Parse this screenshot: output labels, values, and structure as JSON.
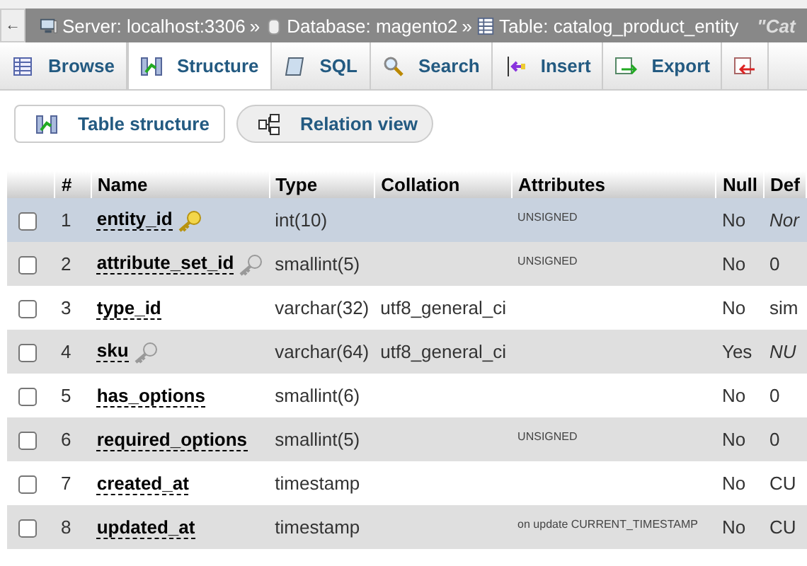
{
  "breadcrumb": {
    "back": "←",
    "items": [
      {
        "kind": "server",
        "label": "Server: localhost:3306"
      },
      {
        "kind": "database",
        "label": "Database: magento2"
      },
      {
        "kind": "table",
        "label": "Table: catalog_product_entity"
      }
    ],
    "separator": "»",
    "comment": "\"Cat"
  },
  "tabs": [
    {
      "kind": "browse",
      "label": "Browse",
      "selected": false
    },
    {
      "kind": "structure",
      "label": "Structure",
      "selected": true
    },
    {
      "kind": "sql",
      "label": "SQL",
      "selected": false
    },
    {
      "kind": "search",
      "label": "Search",
      "selected": false
    },
    {
      "kind": "insert",
      "label": "Insert",
      "selected": false
    },
    {
      "kind": "export",
      "label": "Export",
      "selected": false
    },
    {
      "kind": "import",
      "selected": false
    }
  ],
  "subtabs": [
    {
      "kind": "structure",
      "label": "Table structure",
      "selected": true
    },
    {
      "kind": "relation",
      "label": "Relation view",
      "selected": false
    }
  ],
  "table": {
    "columns": [
      "#",
      "Name",
      "Type",
      "Collation",
      "Attributes",
      "Null",
      "Def"
    ],
    "rows": [
      {
        "num": "1",
        "name": "entity_id",
        "kind": "primary_key",
        "type": "int(10)",
        "collation": "",
        "attributes": "UNSIGNED",
        "null": "No",
        "default": "Nor",
        "default_italic": true,
        "highlighted": true,
        "checked": false
      },
      {
        "num": "2",
        "name": "attribute_set_id",
        "kind": "index_key",
        "type": "smallint(5)",
        "collation": "",
        "attributes": "UNSIGNED",
        "null": "No",
        "default": "0",
        "default_italic": false,
        "highlighted": false,
        "checked": false
      },
      {
        "num": "3",
        "name": "type_id",
        "kind": "plain",
        "type": "varchar(32)",
        "collation": "utf8_general_ci",
        "attributes": "",
        "null": "No",
        "default": "sim",
        "default_italic": false,
        "highlighted": false,
        "checked": false
      },
      {
        "num": "4",
        "name": "sku",
        "kind": "index_key",
        "type": "varchar(64)",
        "collation": "utf8_general_ci",
        "attributes": "",
        "null": "Yes",
        "default": "NU",
        "default_italic": true,
        "highlighted": false,
        "checked": false
      },
      {
        "num": "5",
        "name": "has_options",
        "kind": "plain",
        "type": "smallint(6)",
        "collation": "",
        "attributes": "",
        "null": "No",
        "default": "0",
        "default_italic": false,
        "highlighted": false,
        "checked": false
      },
      {
        "num": "6",
        "name": "required_options",
        "kind": "plain",
        "type": "smallint(5)",
        "collation": "",
        "attributes": "UNSIGNED",
        "null": "No",
        "default": "0",
        "default_italic": false,
        "highlighted": false,
        "checked": false
      },
      {
        "num": "7",
        "name": "created_at",
        "kind": "plain",
        "type": "timestamp",
        "collation": "",
        "attributes": "",
        "null": "No",
        "default": "CU",
        "default_italic": false,
        "highlighted": false,
        "checked": false
      },
      {
        "num": "8",
        "name": "updated_at",
        "kind": "plain",
        "type": "timestamp",
        "collation": "",
        "attributes": "on update CURRENT_TIMESTAMP",
        "null": "No",
        "default": "CU",
        "default_italic": false,
        "highlighted": false,
        "checked": false
      }
    ]
  }
}
